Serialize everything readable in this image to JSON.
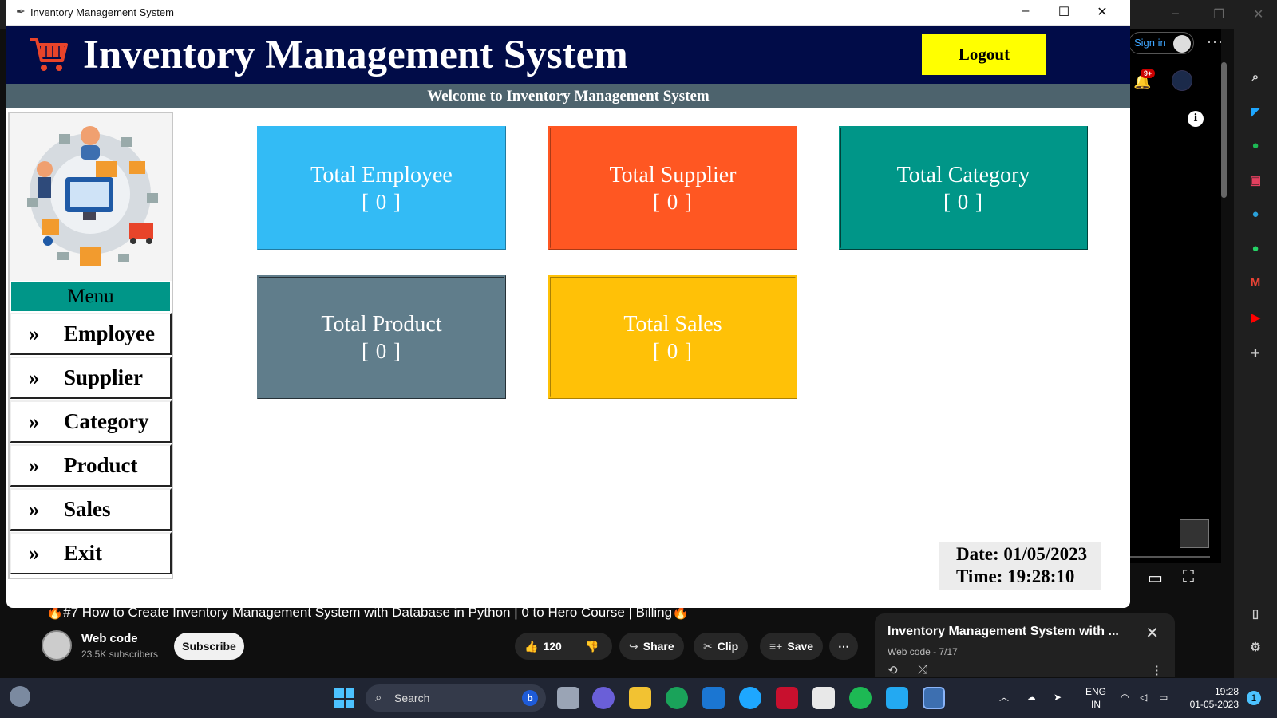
{
  "window": {
    "title": "Inventory Management System",
    "minimize_glyph": "–",
    "maximize_glyph": "☐",
    "close_glyph": "✕"
  },
  "header": {
    "title": "Inventory Management System",
    "logout_label": "Logout",
    "welcome_text": "Welcome to Inventory Management System"
  },
  "menu": {
    "heading": "Menu",
    "chevron": "»",
    "items": [
      {
        "label": "Employee"
      },
      {
        "label": "Supplier"
      },
      {
        "label": "Category"
      },
      {
        "label": "Product"
      },
      {
        "label": "Sales"
      },
      {
        "label": "Exit"
      }
    ]
  },
  "cards": [
    {
      "title": "Total Employee",
      "value": "[ 0 ]",
      "color": "#33bbf5"
    },
    {
      "title": "Total Supplier",
      "value": "[ 0 ]",
      "color": "#ff5722"
    },
    {
      "title": "Total Category",
      "value": "[ 0 ]",
      "color": "#009688"
    },
    {
      "title": "Total Product",
      "value": "[ 0 ]",
      "color": "#607d8b"
    },
    {
      "title": "Total Sales",
      "value": "[ 0 ]",
      "color": "#ffc107"
    }
  ],
  "footer": {
    "date": "Date: 01/05/2023",
    "time": "Time: 19:28:10"
  },
  "youtube": {
    "signin": "Sign in",
    "notification_badge": "9+",
    "video_title": "🔥#7 How to Create Inventory Management System with Database in Python | 0 to Hero Course | Billing🔥",
    "channel_name": "Web code",
    "channel_subs": "23.5K subscribers",
    "subscribe_label": "Subscribe",
    "likes": "120",
    "share_label": "Share",
    "clip_label": "Clip",
    "save_label": "Save",
    "more_glyph": "⋯",
    "playlist_title": "Inventory Management System with ...",
    "playlist_sub": "Web code - 7/17"
  },
  "taskbar": {
    "search_placeholder": "Search",
    "lang_line1": "ENG",
    "lang_line2": "IN",
    "clock_time": "19:28",
    "clock_date": "01-05-2023",
    "notification_count": "1"
  },
  "colors": {
    "header_bg": "#010c48",
    "welcome_bg": "#4d636d",
    "logout_bg": "#ffff00",
    "menu_head_bg": "#009688"
  }
}
